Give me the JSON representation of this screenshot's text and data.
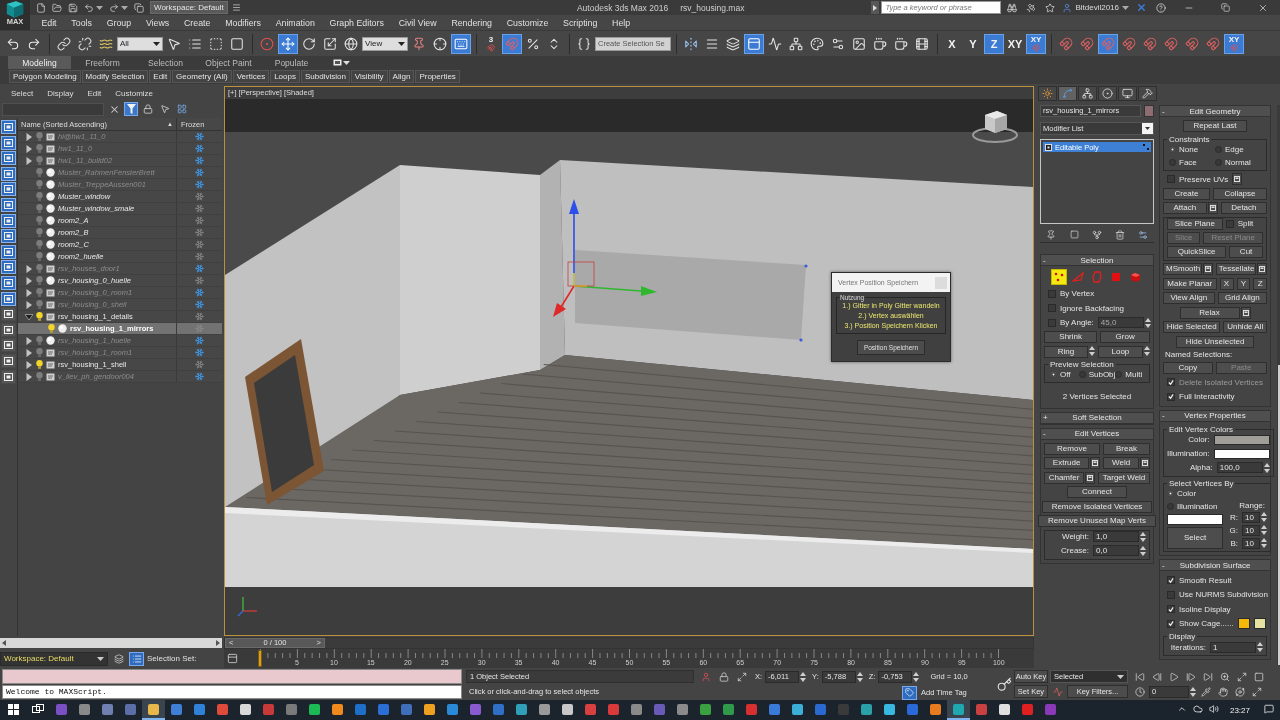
{
  "title_bar": {
    "logo": "MAX",
    "workspace": "Workspace: Default",
    "title": "Autodesk 3ds Max 2016",
    "file": "rsv_housing.max",
    "search": {
      "placeholder": "Type a keyword or phrase"
    },
    "user": "Bitdevil2016"
  },
  "menu_bar": [
    "Edit",
    "Tools",
    "Group",
    "Views",
    "Create",
    "Modifiers",
    "Animation",
    "Graph Editors",
    "Civil View",
    "Rendering",
    "Customize",
    "Scripting",
    "Help"
  ],
  "main_toolbar": {
    "groups": [
      [
        {
          "kind": "undo",
          "active": false
        },
        {
          "kind": "redo",
          "active": false
        }
      ],
      [
        {
          "kind": "link",
          "active": false
        },
        {
          "kind": "unlink",
          "active": false
        },
        {
          "kind": "bind",
          "active": false
        },
        {
          "kind": "dropdown",
          "value": "All"
        },
        {
          "kind": "select",
          "active": false
        },
        {
          "kind": "byname",
          "active": false
        },
        {
          "kind": "region",
          "active": false
        },
        {
          "kind": "crossing",
          "active": false
        }
      ],
      [
        {
          "kind": "manipulator",
          "active": false
        },
        {
          "kind": "move",
          "active": true
        },
        {
          "kind": "rotate",
          "active": false
        },
        {
          "kind": "scale",
          "active": false
        },
        {
          "kind": "place",
          "active": false
        },
        {
          "kind": "dropdown",
          "value": "View"
        },
        {
          "kind": "pivot",
          "active": false
        },
        {
          "kind": "crosshair",
          "active": false
        },
        {
          "kind": "keyboard",
          "active": true
        }
      ],
      [
        {
          "kind": "textsnap",
          "label": "3",
          "active": false
        },
        {
          "kind": "magnet",
          "active": true
        },
        {
          "kind": "percent",
          "active": false
        },
        {
          "kind": "spinner",
          "active": false
        }
      ],
      [
        {
          "kind": "namedsel",
          "active": false
        },
        {
          "kind": "field",
          "value": "Create Selection Se"
        }
      ],
      [
        {
          "kind": "mirror",
          "active": false
        },
        {
          "kind": "align",
          "active": false
        },
        {
          "kind": "layers",
          "active": false
        },
        {
          "kind": "ribbon",
          "active": true
        },
        {
          "kind": "curves",
          "active": false
        },
        {
          "kind": "schematic",
          "active": false
        },
        {
          "kind": "material",
          "active": false
        },
        {
          "kind": "rendersetup",
          "active": false
        },
        {
          "kind": "frame",
          "active": false
        },
        {
          "kind": "render",
          "active": false
        },
        {
          "kind": "render",
          "active": false
        },
        {
          "kind": "film",
          "active": false
        }
      ],
      [
        {
          "kind": "text",
          "label": "X",
          "active": false
        },
        {
          "kind": "text",
          "label": "Y",
          "active": false
        },
        {
          "kind": "text",
          "label": "Z",
          "active": true
        },
        {
          "kind": "text",
          "label": "XY",
          "active": false
        },
        {
          "kind": "textsnap",
          "label": "XY",
          "active": true
        }
      ],
      [
        {
          "kind": "magnet",
          "active": false
        },
        {
          "kind": "magnet",
          "active": false
        },
        {
          "kind": "magnet",
          "active": true
        },
        {
          "kind": "magnet",
          "active": false
        },
        {
          "kind": "magnet",
          "active": false
        },
        {
          "kind": "magnet",
          "active": false
        },
        {
          "kind": "magnet",
          "active": false
        },
        {
          "kind": "magnet",
          "active": false
        },
        {
          "kind": "textsnap",
          "label": "XY",
          "active": true
        }
      ]
    ]
  },
  "ribbon": {
    "tabs": [
      {
        "label": "Modeling",
        "selected": true
      },
      {
        "label": "Freeform",
        "selected": false
      },
      {
        "label": "Selection",
        "selected": false
      },
      {
        "label": "Object Paint",
        "selected": false
      },
      {
        "label": "Populate",
        "selected": false
      }
    ],
    "panels": [
      "Polygon Modeling",
      "Modify Selection",
      "Edit",
      "Geometry (All)",
      "Vertices",
      "Loops",
      "Subdivision",
      "Visibility",
      "Align",
      "Properties"
    ]
  },
  "scene_explorer": {
    "menu": [
      "Select",
      "Display",
      "Edit",
      "Customize"
    ],
    "filter_on": true,
    "display_filters": [
      {
        "active": true
      },
      {
        "active": true
      },
      {
        "active": true
      },
      {
        "active": true
      },
      {
        "active": true
      },
      {
        "active": true
      },
      {
        "active": true
      },
      {
        "active": true
      },
      {
        "active": true
      },
      {
        "active": true
      },
      {
        "active": true
      },
      {
        "active": true
      },
      {
        "active": false
      },
      {
        "active": false
      },
      {
        "active": false
      },
      {
        "active": false
      },
      {
        "active": false
      }
    ],
    "columns": [
      "Name (Sorted Ascending)",
      "Frozen"
    ],
    "sort_mark": "▲",
    "items": [
      {
        "name": "hi@hw1_11_0",
        "kind": "group",
        "has_children": true,
        "expanded": false,
        "visible": false,
        "frozen": true,
        "selected": false
      },
      {
        "name": "hw1_11_0",
        "kind": "group",
        "has_children": true,
        "expanded": false,
        "visible": false,
        "frozen": true,
        "selected": false
      },
      {
        "name": "hw1_11_build02",
        "kind": "group",
        "has_children": true,
        "expanded": false,
        "visible": false,
        "frozen": true,
        "selected": false
      },
      {
        "name": "Muster_RahmenFensterBrett",
        "kind": "object",
        "has_children": false,
        "visible": false,
        "frozen": true,
        "selected": false
      },
      {
        "name": "Muster_TreppeAussen001",
        "kind": "object",
        "has_children": false,
        "visible": false,
        "frozen": true,
        "selected": false
      },
      {
        "name": "Muster_window",
        "kind": "object",
        "has_children": false,
        "visible": false,
        "frozen": false,
        "selected": false
      },
      {
        "name": "Muster_window_smale",
        "kind": "object",
        "has_children": false,
        "visible": false,
        "frozen": false,
        "selected": false
      },
      {
        "name": "room2_A",
        "kind": "object",
        "has_children": false,
        "visible": false,
        "frozen": false,
        "selected": false
      },
      {
        "name": "room2_B",
        "kind": "object",
        "has_children": false,
        "visible": false,
        "frozen": false,
        "selected": false
      },
      {
        "name": "room2_C",
        "kind": "object",
        "has_children": false,
        "visible": false,
        "frozen": false,
        "selected": false
      },
      {
        "name": "room2_huelle",
        "kind": "object",
        "has_children": false,
        "visible": false,
        "frozen": false,
        "selected": false
      },
      {
        "name": "rsv_houses_door1",
        "kind": "group",
        "has_children": true,
        "expanded": false,
        "visible": false,
        "frozen": true,
        "selected": false
      },
      {
        "name": "rsv_housing_0_huelle",
        "kind": "object",
        "has_children": true,
        "expanded": false,
        "visible": false,
        "frozen": false,
        "selected": false
      },
      {
        "name": "rsv_housing_0_room1",
        "kind": "group",
        "has_children": true,
        "expanded": false,
        "visible": false,
        "frozen": true,
        "selected": false
      },
      {
        "name": "rsv_housing_0_shell",
        "kind": "group",
        "has_children": true,
        "expanded": false,
        "visible": false,
        "frozen": true,
        "selected": false
      },
      {
        "name": "rsv_housing_1_details",
        "kind": "group",
        "has_children": true,
        "expanded": true,
        "visible": true,
        "frozen": false,
        "selected": false,
        "children": [
          {
            "name": "rsv_housing_1_mirrors",
            "kind": "object",
            "has_children": false,
            "visible": true,
            "frozen": false,
            "selected": true
          }
        ]
      },
      {
        "name": "rsv_housing_1_huelle",
        "kind": "object",
        "has_children": true,
        "expanded": false,
        "visible": false,
        "frozen": true,
        "selected": false
      },
      {
        "name": "rsv_housing_1_room1",
        "kind": "group",
        "has_children": true,
        "expanded": false,
        "visible": false,
        "frozen": true,
        "selected": false
      },
      {
        "name": "rsv_housing_1_shell",
        "kind": "group",
        "has_children": true,
        "expanded": false,
        "visible": true,
        "frozen": false,
        "selected": false
      },
      {
        "name": "v_ilev_ph_gendoor004",
        "kind": "group",
        "has_children": true,
        "expanded": false,
        "visible": false,
        "frozen": true,
        "selected": false
      }
    ]
  },
  "viewport": {
    "labels": [
      "[+]",
      "[Perspective]",
      "[Shaded]"
    ]
  },
  "dialog": {
    "title": "Vertex Position Speichern",
    "group_title": "Nutzung",
    "steps": [
      "1.) Gitter in Poly Gitter wandeln",
      "2.) Vertex auswählen",
      "3.) Position Speichern Klicken"
    ],
    "button": "Position Speichern"
  },
  "command_panel": {
    "tabs": [
      {
        "kind": "create",
        "selected": false
      },
      {
        "kind": "modify",
        "selected": true
      },
      {
        "kind": "hierarchy",
        "selected": false
      },
      {
        "kind": "motion",
        "selected": false
      },
      {
        "kind": "display",
        "selected": false
      },
      {
        "kind": "utilities",
        "selected": false
      }
    ],
    "object_name": "rsv_housing_1_mirrors",
    "modifier_list": "Modifier List",
    "stack": [
      {
        "label": "Editable Poly",
        "selected": true
      }
    ],
    "left_rollouts": [
      {
        "sign": "-",
        "title": "Selection",
        "rows": [
          {
            "kind": "subobjects",
            "items": [
              {
                "kind": "vertex",
                "selected": true
              },
              {
                "kind": "edge",
                "selected": false
              },
              {
                "kind": "border",
                "selected": false
              },
              {
                "kind": "polygon",
                "selected": false
              },
              {
                "kind": "element",
                "selected": false
              }
            ]
          },
          {
            "kind": "check",
            "label": "By Vertex",
            "checked": false,
            "disabled": false,
            "settings": false
          },
          {
            "kind": "check",
            "label": "Ignore Backfacing",
            "checked": false,
            "disabled": false,
            "settings": false
          },
          {
            "kind": "check_spinner",
            "label": "By Angle:",
            "checked": false,
            "value": "45,0"
          },
          {
            "kind": "buttons",
            "items": [
              {
                "kind": "button",
                "label": "Shrink",
                "disabled": false,
                "settings": false
              },
              {
                "kind": "button",
                "label": "Grow",
                "disabled": false,
                "settings": false
              }
            ]
          },
          {
            "kind": "buttons",
            "items": [
              {
                "kind": "spin_button",
                "label": "Ring",
                "disabled": false,
                "settings": false
              },
              {
                "kind": "spin_button",
                "label": "Loop",
                "disabled": false,
                "settings": false
              }
            ]
          },
          {
            "kind": "group",
            "title": "Preview Selection",
            "rows": [
              {
                "kind": "radios",
                "items": [
                  {
                    "label": "Off",
                    "selected": true
                  },
                  {
                    "label": "SubObj",
                    "selected": false
                  },
                  {
                    "label": "Multi",
                    "selected": false
                  }
                ]
              }
            ]
          },
          {
            "kind": "status",
            "text": "2 Vertices Selected"
          }
        ]
      },
      {
        "sign": "+",
        "title": "Soft Selection"
      },
      {
        "sign": "-",
        "title": "Edit Vertices",
        "rows": [
          {
            "kind": "buttons",
            "items": [
              {
                "kind": "button",
                "label": "Remove",
                "disabled": false,
                "settings": false
              },
              {
                "kind": "button",
                "label": "Break",
                "disabled": false,
                "settings": false
              }
            ]
          },
          {
            "kind": "buttons",
            "items": [
              {
                "kind": "button",
                "label": "Extrude",
                "disabled": false,
                "settings": true
              },
              {
                "kind": "button",
                "label": "Weld",
                "disabled": false,
                "settings": true
              }
            ]
          },
          {
            "kind": "buttons",
            "items": [
              {
                "kind": "button",
                "label": "Chamfer",
                "disabled": false,
                "settings": true
              },
              {
                "kind": "button",
                "label": "Target Weld",
                "disabled": false,
                "settings": false
              }
            ]
          },
          {
            "kind": "buttons",
            "items": [
              {
                "kind": "button",
                "label": "Connect",
                "disabled": false,
                "settings": false
              }
            ]
          },
          {
            "kind": "buttons",
            "items": [
              {
                "kind": "button",
                "label": "Remove Isolated Vertices",
                "disabled": false,
                "settings": false
              }
            ]
          },
          {
            "kind": "buttons",
            "items": [
              {
                "kind": "button",
                "label": "Remove Unused Map Verts",
                "disabled": false,
                "settings": false
              }
            ]
          },
          {
            "kind": "group",
            "rows": [
              {
                "kind": "spinner",
                "label": "Weight:",
                "value": "1,0"
              },
              {
                "kind": "spinner",
                "label": "Crease:",
                "value": "0,0"
              }
            ]
          }
        ]
      }
    ],
    "right_rollouts": [
      {
        "sign": "-",
        "title": "Edit Geometry",
        "rows": [
          {
            "kind": "buttons",
            "items": [
              {
                "kind": "button",
                "label": "Repeat Last",
                "disabled": false,
                "settings": false
              }
            ]
          },
          {
            "kind": "group",
            "title": "Constraints",
            "rows": [
              {
                "kind": "radios",
                "items": [
                  {
                    "label": "None",
                    "selected": true
                  },
                  {
                    "label": "Edge",
                    "selected": false
                  },
                  {
                    "label": "Face",
                    "selected": false
                  },
                  {
                    "label": "Normal",
                    "selected": false
                  }
                ]
              }
            ]
          },
          {
            "kind": "check",
            "label": "Preserve UVs",
            "checked": false,
            "disabled": false,
            "settings": true
          },
          {
            "kind": "buttons",
            "items": [
              {
                "kind": "button",
                "label": "Create",
                "disabled": false,
                "settings": false
              },
              {
                "kind": "button",
                "label": "Collapse",
                "disabled": false,
                "settings": false
              }
            ]
          },
          {
            "kind": "buttons",
            "items": [
              {
                "kind": "button",
                "label": "Attach",
                "disabled": false,
                "settings": true
              },
              {
                "kind": "button",
                "label": "Detach",
                "disabled": false,
                "settings": false
              }
            ]
          },
          {
            "kind": "group",
            "rows": [
              {
                "kind": "buttons",
                "items": [
                  {
                    "kind": "button",
                    "label": "Slice Plane",
                    "disabled": false,
                    "settings": false
                  },
                  {
                    "kind": "check",
                    "label": "Split",
                    "checked": false,
                    "disabled": false,
                    "settings": false
                  }
                ]
              },
              {
                "kind": "buttons",
                "items": [
                  {
                    "kind": "button",
                    "label": "Slice",
                    "disabled": true,
                    "settings": false
                  },
                  {
                    "kind": "button",
                    "label": "Reset Plane",
                    "disabled": true,
                    "settings": false
                  }
                ]
              },
              {
                "kind": "buttons",
                "items": [
                  {
                    "kind": "button",
                    "label": "QuickSlice",
                    "disabled": false,
                    "settings": false
                  },
                  {
                    "kind": "button",
                    "label": "Cut",
                    "disabled": false,
                    "settings": false
                  }
                ]
              }
            ]
          },
          {
            "kind": "buttons",
            "items": [
              {
                "kind": "button",
                "label": "MSmooth",
                "disabled": false,
                "settings": true
              },
              {
                "kind": "button",
                "label": "Tessellate",
                "disabled": false,
                "settings": true
              }
            ]
          },
          {
            "kind": "buttons",
            "items": [
              {
                "kind": "button",
                "label": "Make Planar",
                "disabled": false,
                "settings": false
              },
              {
                "kind": "button",
                "label": "X",
                "disabled": false,
                "settings": false
              },
              {
                "kind": "button",
                "label": "Y",
                "disabled": false,
                "settings": false
              },
              {
                "kind": "button",
                "label": "Z",
                "disabled": false,
                "settings": false
              }
            ]
          },
          {
            "kind": "buttons",
            "items": [
              {
                "kind": "button",
                "label": "View Align",
                "disabled": false,
                "settings": false
              },
              {
                "kind": "button",
                "label": "Grid Align",
                "disabled": false,
                "settings": false
              }
            ]
          },
          {
            "kind": "buttons",
            "items": [
              {
                "kind": "button",
                "label": "Relax",
                "disabled": false,
                "settings": true
              }
            ]
          },
          {
            "kind": "buttons",
            "items": [
              {
                "kind": "button",
                "label": "Hide Selected",
                "disabled": false,
                "settings": false
              },
              {
                "kind": "button",
                "label": "Unhide All",
                "disabled": false,
                "settings": false
              }
            ]
          },
          {
            "kind": "buttons",
            "items": [
              {
                "kind": "button",
                "label": "Hide Unselected",
                "disabled": false,
                "settings": false
              }
            ]
          },
          {
            "kind": "label",
            "text": "Named Selections:"
          },
          {
            "kind": "buttons",
            "items": [
              {
                "kind": "button",
                "label": "Copy",
                "disabled": false,
                "settings": false
              },
              {
                "kind": "button",
                "label": "Paste",
                "disabled": true,
                "settings": false
              }
            ]
          },
          {
            "kind": "check",
            "label": "Delete Isolated Vertices",
            "checked": true,
            "disabled": true,
            "settings": false
          },
          {
            "kind": "check",
            "label": "Full Interactivity",
            "checked": true,
            "disabled": false,
            "settings": false
          }
        ]
      },
      {
        "sign": "-",
        "title": "Vertex Properties",
        "rows": [
          {
            "kind": "group",
            "title": "Edit Vertex Colors",
            "rows": [
              {
                "kind": "swatch",
                "label": "Color:",
                "color": "#a19e9a"
              },
              {
                "kind": "swatch",
                "label": "Illumination:",
                "color": "#ffffff"
              },
              {
                "kind": "spinner",
                "label": "Alpha:",
                "value": "100,0"
              }
            ]
          },
          {
            "kind": "group",
            "title": "Select Vertices By",
            "rows": [
              {
                "kind": "select_by",
                "radios": [
                  {
                    "label": "Color",
                    "selected": true
                  },
                  {
                    "label": "Illumination",
                    "selected": false
                  }
                ],
                "color": "#ffffff",
                "button": "Select",
                "range_label": "Range:",
                "channels": [
                  {
                    "label": "R:",
                    "value": "10"
                  },
                  {
                    "label": "G:",
                    "value": "10"
                  },
                  {
                    "label": "B:",
                    "value": "10"
                  }
                ]
              }
            ]
          }
        ]
      },
      {
        "sign": "-",
        "title": "Subdivision Surface",
        "rows": [
          {
            "kind": "check",
            "label": "Smooth Result",
            "checked": true,
            "disabled": false,
            "settings": false
          },
          {
            "kind": "check",
            "label": "Use NURMS Subdivision",
            "checked": false,
            "disabled": false,
            "settings": false
          },
          {
            "kind": "check",
            "label": "Isoline Display",
            "checked": true,
            "disabled": false,
            "settings": false
          },
          {
            "kind": "check",
            "label": "Show Cage......",
            "checked": true,
            "disabled": false,
            "settings": false,
            "swatches": [
              {
                "color": "#f5b90a"
              },
              {
                "color": "#e6e3a2"
              }
            ]
          },
          {
            "kind": "group",
            "title": "Display",
            "rows": [
              {
                "kind": "spinner",
                "label": "Iterations:",
                "value": "1"
              }
            ]
          }
        ]
      }
    ]
  },
  "time_slider": {
    "prev": "<",
    "label": "0 / 100",
    "next": ">",
    "level": 0
  },
  "track_bar": {
    "workspace": "Workspace: Default",
    "selection_set": "Selection Set:",
    "ticks": [
      "5",
      "10",
      "15",
      "20",
      "25",
      "30",
      "35",
      "40",
      "45",
      "50",
      "55",
      "60",
      "65",
      "70",
      "75",
      "80",
      "85",
      "90",
      "95",
      "100"
    ]
  },
  "status_bar": {
    "maxscript_output": "Welcome to MAXScript.",
    "selection_info": "1 Object Selected",
    "prompt": "Click or click-and-drag to select objects",
    "coords": [
      {
        "label": "X:",
        "value": "-6,011"
      },
      {
        "label": "Y:",
        "value": "-5,788"
      },
      {
        "label": "Z:",
        "value": "-0,753"
      }
    ],
    "grid": "Grid = 10,0",
    "time_tag": "Add Time Tag"
  },
  "animation_controls": {
    "auto_key": "Auto Key",
    "key_mode": "Selected",
    "set_key": "Set Key",
    "key_filters": "Key Filters...",
    "frame": "0"
  },
  "taskbar": {
    "apps": [
      {
        "color": "#7b4fc4",
        "active": false
      },
      {
        "color": "#8a8a8a",
        "active": false
      },
      {
        "color": "#6f7fb0",
        "active": false
      },
      {
        "color": "#5b6ea8",
        "active": false
      },
      {
        "color": "#e8b84a",
        "active": true
      },
      {
        "color": "#3f7fd6",
        "active": false
      },
      {
        "color": "#2f82d8",
        "active": false
      },
      {
        "color": "#e04a3b",
        "active": false
      },
      {
        "color": "#d9d9d9",
        "active": false
      },
      {
        "color": "#c83a3a",
        "active": false
      },
      {
        "color": "#7a7a7a",
        "active": false
      },
      {
        "color": "#1db954",
        "active": false
      },
      {
        "color": "#f08a1c",
        "active": false
      },
      {
        "color": "#1e6fc8",
        "active": false
      },
      {
        "color": "#2b6fd6",
        "active": false
      },
      {
        "color": "#3f6fb8",
        "active": false
      },
      {
        "color": "#f0a020",
        "active": false
      },
      {
        "color": "#2a8ad8",
        "active": false
      },
      {
        "color": "#8a5ad0",
        "active": false
      },
      {
        "color": "#2f6fc8",
        "active": false
      },
      {
        "color": "#2fa0b8",
        "active": false
      },
      {
        "color": "#9a9a9a",
        "active": false
      },
      {
        "color": "#c8c8c8",
        "active": false
      },
      {
        "color": "#d84040",
        "active": false
      },
      {
        "color": "#d83a3a",
        "active": false
      },
      {
        "color": "#8a8a8a",
        "active": false
      },
      {
        "color": "#6a5ab8",
        "active": false
      },
      {
        "color": "#8b8b8b",
        "active": false
      },
      {
        "color": "#3aa040",
        "active": false
      },
      {
        "color": "#2f9a4a",
        "active": false
      },
      {
        "color": "#d83030",
        "active": false
      },
      {
        "color": "#3a7ad8",
        "active": false
      },
      {
        "color": "#3ab0d8",
        "active": false
      },
      {
        "color": "#2a6ad0",
        "active": false
      },
      {
        "color": "#3a3a3a",
        "active": false
      },
      {
        "color": "#2aa0a8",
        "active": false
      },
      {
        "color": "#38b8e0",
        "active": false
      },
      {
        "color": "#2a6ad8",
        "active": false
      },
      {
        "color": "#e87a20",
        "active": false
      },
      {
        "color": "#1fa8b0",
        "active": true
      },
      {
        "color": "#c84040",
        "active": false
      },
      {
        "color": "#e0e0e0",
        "active": false
      },
      {
        "color": "#e02020",
        "active": false
      },
      {
        "color": "#8a3ab8",
        "active": false
      }
    ],
    "clock": "23:27"
  }
}
